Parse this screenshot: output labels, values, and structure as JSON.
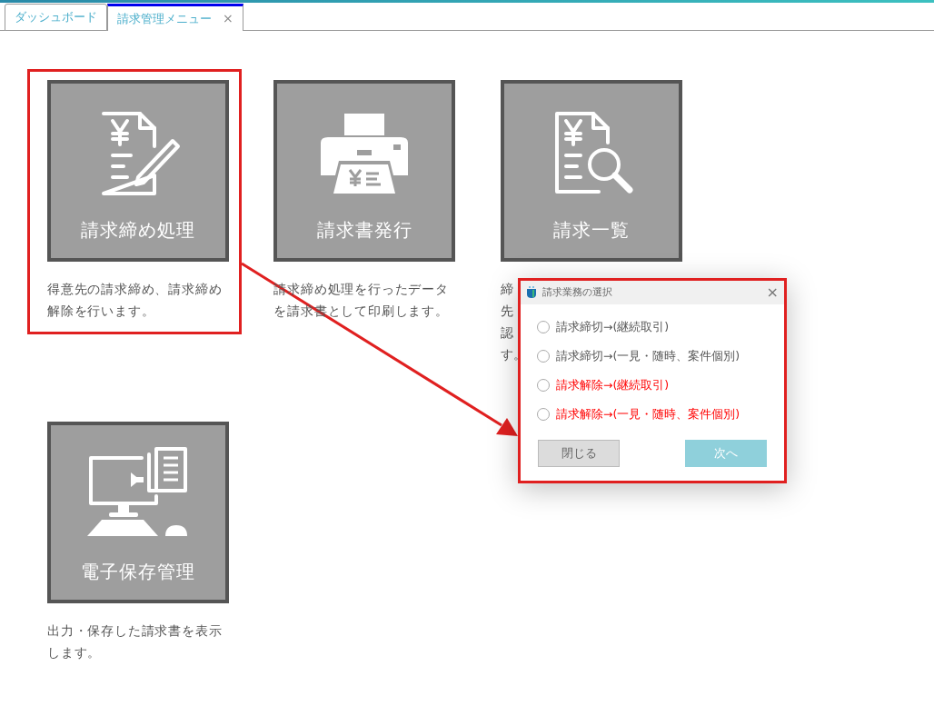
{
  "tabs": [
    {
      "label": "ダッシュボード",
      "selected": false,
      "closable": false
    },
    {
      "label": "請求管理メニュー",
      "selected": true,
      "closable": true,
      "close_label": "×"
    }
  ],
  "tiles": [
    {
      "kind": "yen-pencil",
      "label": "請求締め処理",
      "description_lines": [
        "得意先の請求締め、請求締め",
        "解除を行います。"
      ],
      "highlighted": true
    },
    {
      "kind": "printer",
      "label": "請求書発行",
      "description_lines": [
        "請求締め処理を行ったデータ",
        "を請求書として印刷します。"
      ],
      "highlighted": false
    },
    {
      "kind": "yen-search",
      "label": "請求一覧",
      "description_lines": [
        "締",
        "先",
        "認",
        "す。"
      ],
      "highlighted": false
    },
    {
      "kind": "computer",
      "label": "電子保存管理",
      "description_lines": [
        "出力・保存した請求書を表示",
        "します。"
      ],
      "highlighted": false
    }
  ],
  "dialog": {
    "title": "請求業務の選択",
    "close_label": "×",
    "highlighted": true,
    "options": [
      {
        "label": "請求締切→(継続取引)",
        "kind": "close",
        "selected": false
      },
      {
        "label": "請求締切→(一見・随時、案件個別)",
        "kind": "close",
        "selected": false
      },
      {
        "label": "請求解除→(継続取引)",
        "kind": "release",
        "selected": false
      },
      {
        "label": "請求解除→(一見・随時、案件個別)",
        "kind": "release",
        "selected": false
      }
    ],
    "buttons": [
      {
        "label": "閉じる",
        "kind": "secondary",
        "disabled": false
      },
      {
        "label": "次へ",
        "kind": "primary",
        "disabled": true
      }
    ]
  }
}
